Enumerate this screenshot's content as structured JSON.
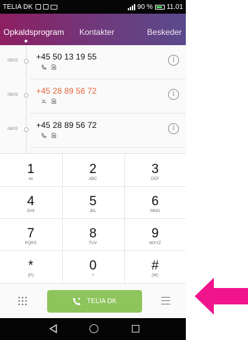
{
  "status_bar": {
    "carrier": "TELIA DK",
    "battery": "90 %",
    "time": "11.01"
  },
  "tabs": [
    {
      "label": "Opkaldsprogram",
      "active": true
    },
    {
      "label": "Kontakter",
      "active": false
    },
    {
      "label": "Beskeder",
      "active": false
    }
  ],
  "call_log": [
    {
      "date": "08/03",
      "number": "+45 50 13 19 55",
      "missed": false,
      "type_icon": "outgoing-call-icon"
    },
    {
      "date": "06/03",
      "number": "+45 28 89 56 72",
      "missed": true,
      "type_icon": "missed-call-icon"
    },
    {
      "date": "06/03",
      "number": "+45 28 89 56 72",
      "missed": false,
      "type_icon": "outgoing-call-icon"
    }
  ],
  "keypad": [
    {
      "digit": "1",
      "letters": "ᴏᴅ"
    },
    {
      "digit": "2",
      "letters": "ABC"
    },
    {
      "digit": "3",
      "letters": "DEF"
    },
    {
      "digit": "4",
      "letters": "GHI"
    },
    {
      "digit": "5",
      "letters": "JKL"
    },
    {
      "digit": "6",
      "letters": "MNO"
    },
    {
      "digit": "7",
      "letters": "PQRS"
    },
    {
      "digit": "8",
      "letters": "TUV"
    },
    {
      "digit": "9",
      "letters": "WXYZ"
    },
    {
      "digit": "*",
      "letters": "(P)"
    },
    {
      "digit": "0",
      "letters": "+"
    },
    {
      "digit": "#",
      "letters": "(W)"
    }
  ],
  "call_button": {
    "label": "TELIA DK"
  },
  "colors": {
    "accent_purple": "#8e1f62",
    "call_green": "#8ec45c",
    "missed_orange": "#e8623a",
    "annotation_pink": "#f0158c"
  }
}
